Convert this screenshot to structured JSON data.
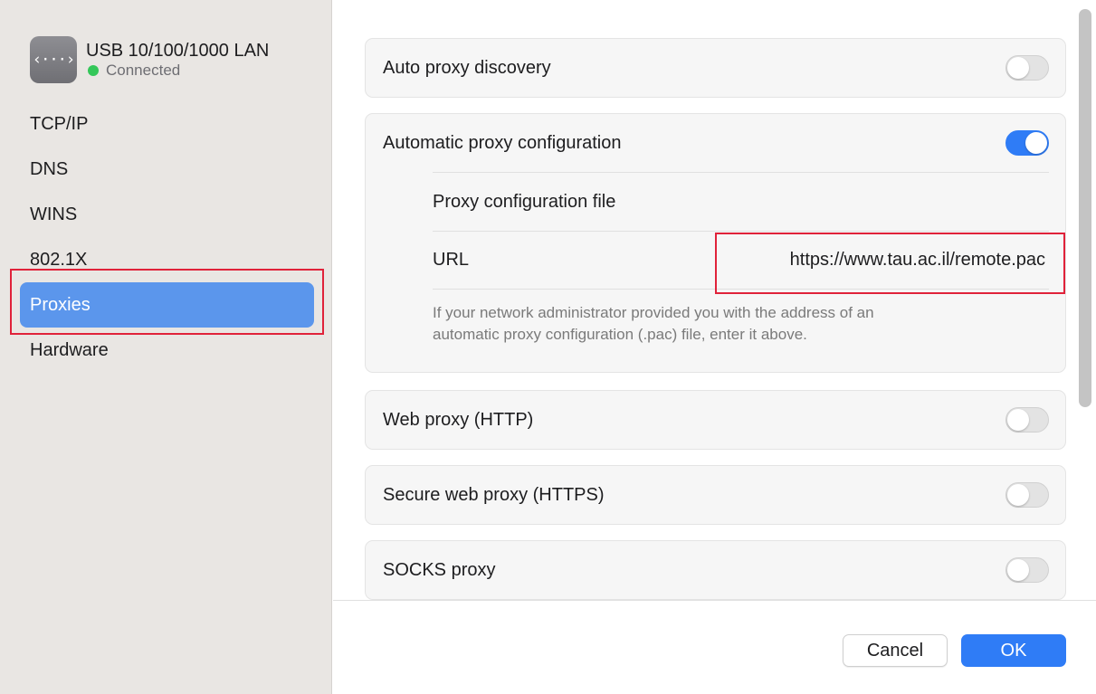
{
  "sidebar": {
    "device": {
      "icon": "network-arrows-icon",
      "icon_glyph": "‹···›",
      "name": "USB 10/100/1000 LAN",
      "status": "Connected",
      "status_color": "#34c759"
    },
    "items": [
      {
        "label": "TCP/IP",
        "active": false
      },
      {
        "label": "DNS",
        "active": false
      },
      {
        "label": "WINS",
        "active": false
      },
      {
        "label": "802.1X",
        "active": false
      },
      {
        "label": "Proxies",
        "active": true
      },
      {
        "label": "Hardware",
        "active": false
      }
    ]
  },
  "proxies": {
    "auto_discovery": {
      "label": "Auto proxy discovery",
      "enabled": false
    },
    "auto_config": {
      "label": "Automatic proxy configuration",
      "enabled": true,
      "file_label": "Proxy configuration file",
      "url_label": "URL",
      "url_value": "https://www.tau.ac.il/remote.pac",
      "help_line1": "If your network administrator provided you with the address of an",
      "help_line2": "automatic proxy configuration (.pac) file, enter it above."
    },
    "web_proxy": {
      "label": "Web proxy (HTTP)",
      "enabled": false
    },
    "secure_web_proxy": {
      "label": "Secure web proxy (HTTPS)",
      "enabled": false
    },
    "socks_proxy": {
      "label": "SOCKS proxy",
      "enabled": false
    }
  },
  "footer": {
    "cancel_label": "Cancel",
    "ok_label": "OK"
  },
  "colors": {
    "accent": "#2f7cf6",
    "selection": "#5b96ec",
    "highlight_box": "#e0223a"
  }
}
